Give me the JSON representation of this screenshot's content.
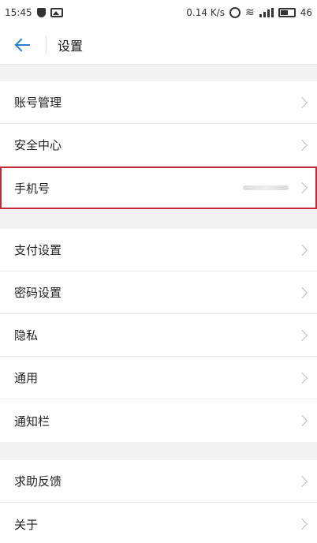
{
  "status_bar": {
    "time": "15:45",
    "network_speed": "0.14 K/s",
    "signal_type": "4G",
    "battery": "46",
    "icons": [
      "shield-icon",
      "gallery-icon",
      "alarm-icon",
      "wifi-icon",
      "signal-icon",
      "battery-icon"
    ]
  },
  "header": {
    "title": "设置",
    "back_icon": "arrow-left-icon",
    "accent_color": "#2a7fd4"
  },
  "groups": [
    {
      "items": [
        {
          "label": "账号管理"
        },
        {
          "label": "安全中心"
        },
        {
          "label": "手机号",
          "value_masked": true,
          "highlighted": true
        }
      ]
    },
    {
      "items": [
        {
          "label": "支付设置"
        },
        {
          "label": "密码设置"
        },
        {
          "label": "隐私"
        },
        {
          "label": "通用"
        },
        {
          "label": "通知栏"
        }
      ]
    },
    {
      "items": [
        {
          "label": "求助反馈"
        },
        {
          "label": "关于"
        }
      ]
    }
  ],
  "highlight_color": "#c4283d"
}
